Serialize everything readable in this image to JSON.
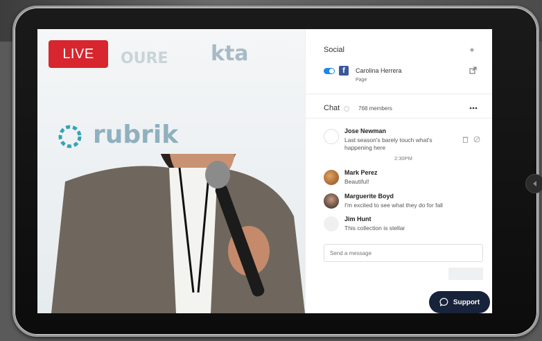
{
  "live_badge": "LIVE",
  "social": {
    "title": "Social",
    "account_name": "Carolina Herrera",
    "account_type": "Page"
  },
  "chat": {
    "title": "Chat",
    "members": "768 members",
    "time_divider": "2:30PM",
    "messages": [
      {
        "name": "Jose Newman",
        "text": "Last season's barely touch what's happening here"
      },
      {
        "name": "Mark Perez",
        "text": "Beautiful!"
      },
      {
        "name": "Marguerite Boyd",
        "text": "I'm excited to see what they do for fall"
      },
      {
        "name": "Jim Hunt",
        "text": "This collection is stellar"
      }
    ],
    "input_placeholder": "Send a message"
  },
  "support_label": "Support",
  "colors": {
    "live_red": "#d7262e",
    "toggle_blue": "#1e88e5",
    "facebook_blue": "#3b5998",
    "support_navy": "#17223b"
  }
}
